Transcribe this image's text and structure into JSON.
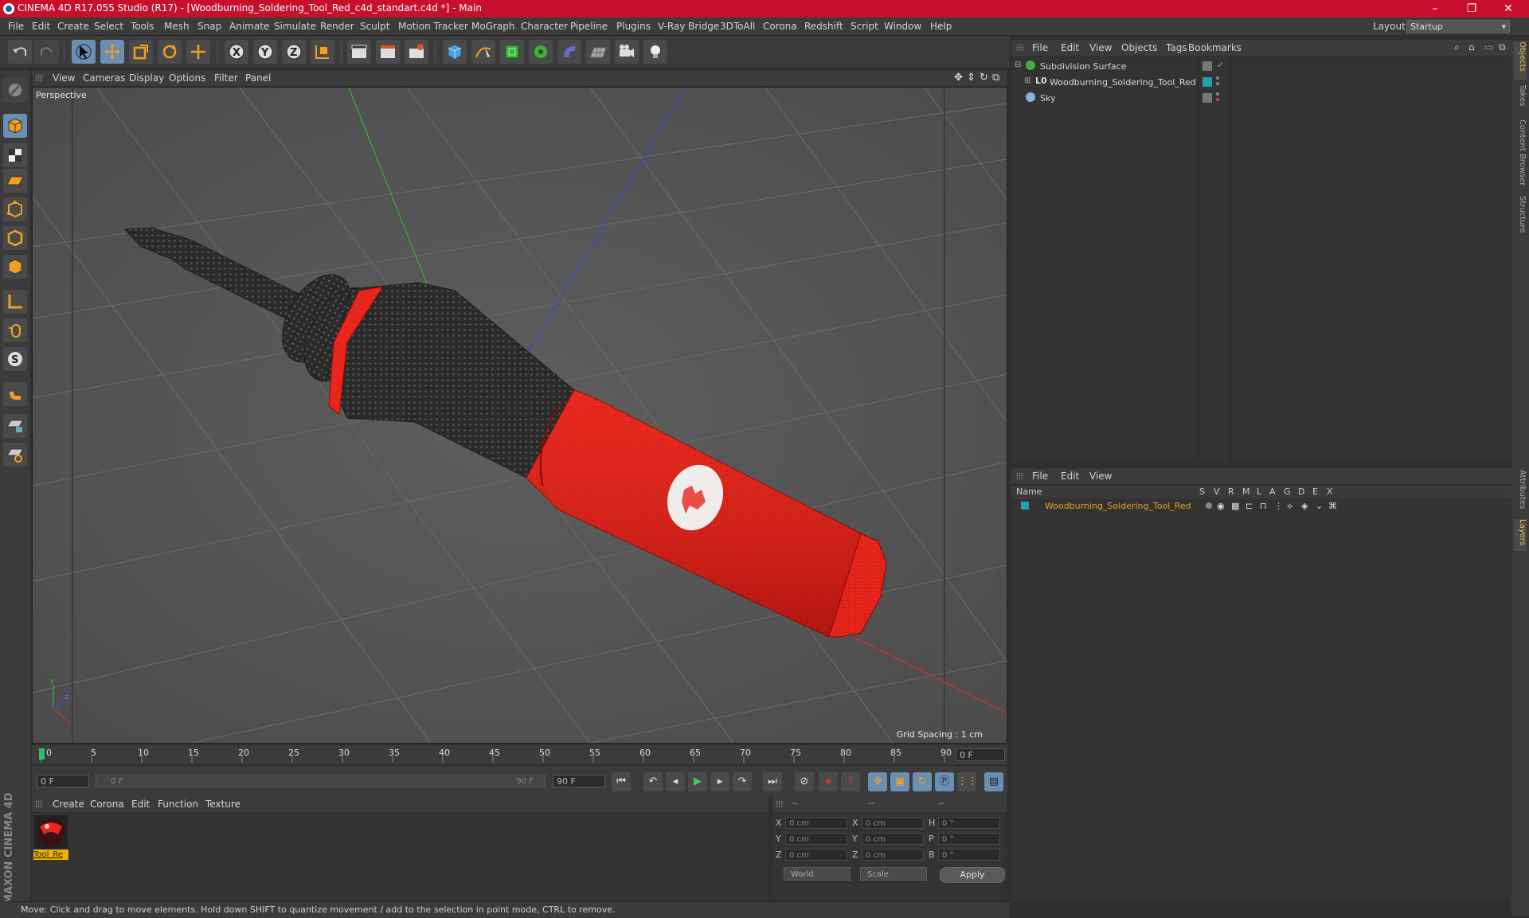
{
  "window": {
    "title": "CINEMA 4D R17.055 Studio (R17) - [Woodburning_Soldering_Tool_Red_c4d_standart.c4d *] - Main",
    "controls": [
      "–",
      "❐",
      "✕"
    ]
  },
  "menubar": {
    "items": [
      "File",
      "Edit",
      "Create",
      "Select",
      "Tools",
      "Mesh",
      "Snap",
      "Animate",
      "Simulate",
      "Render",
      "Sculpt",
      "Motion Tracker",
      "MoGraph",
      "Character",
      "Pipeline",
      "Plugins",
      "V-Ray Bridge",
      "3DToAll",
      "Corona",
      "Redshift",
      "Script",
      "Window",
      "Help"
    ],
    "layout_label": "Layout:",
    "layout_value": "Startup"
  },
  "viewport": {
    "menu": [
      "View",
      "Cameras",
      "Display",
      "Options",
      "Filter",
      "Panel"
    ],
    "label": "Perspective",
    "grid_spacing": "Grid Spacing : 1 cm"
  },
  "timeline": {
    "ticks": [
      "0",
      "5",
      "10",
      "15",
      "20",
      "25",
      "30",
      "35",
      "40",
      "45",
      "50",
      "55",
      "60",
      "65",
      "70",
      "75",
      "80",
      "85",
      "90"
    ],
    "current_frame": "0 F",
    "start_field": "0 F",
    "range_start": "0 F",
    "range_end": "90 F",
    "end_field": "90 F"
  },
  "material_manager": {
    "menu": [
      "Create",
      "Corona",
      "Edit",
      "Function",
      "Texture"
    ],
    "material_name": "Tool_Re"
  },
  "coordinates": {
    "header": [
      "--",
      "--",
      "--"
    ],
    "rows": [
      {
        "l1": "X",
        "v1": "0 cm",
        "l2": "X",
        "v2": "0 cm",
        "l3": "H",
        "v3": "0 °"
      },
      {
        "l1": "Y",
        "v1": "0 cm",
        "l2": "Y",
        "v2": "0 cm",
        "l3": "P",
        "v3": "0 °"
      },
      {
        "l1": "Z",
        "v1": "0 cm",
        "l2": "Z",
        "v2": "0 cm",
        "l3": "B",
        "v3": "0 °"
      }
    ],
    "mode_world": "World",
    "mode_scale": "Scale",
    "apply_label": "Apply"
  },
  "object_manager": {
    "menu": [
      "File",
      "Edit",
      "View",
      "Objects",
      "Tags",
      "Bookmarks"
    ],
    "objects": [
      {
        "name": "Subdivision Surface"
      },
      {
        "name": "Woodburning_Soldering_Tool_Red"
      },
      {
        "name": "Sky"
      }
    ]
  },
  "layers_manager": {
    "menu": [
      "File",
      "Edit",
      "View"
    ],
    "columns": [
      "Name",
      "S",
      "V",
      "R",
      "M",
      "L",
      "A",
      "G",
      "D",
      "E",
      "X"
    ],
    "layer_name": "Woodburning_Soldering_Tool_Red"
  },
  "right_tabs": [
    "Objects",
    "Takes",
    "Content Browser",
    "Structure",
    "Attributes",
    "Layers"
  ],
  "status": "Move: Click and drag to move elements. Hold down SHIFT to quantize movement / add to the selection in point mode, CTRL to remove.",
  "brand": "MAXON CINEMA 4D",
  "colors": {
    "title_bar": "#c8102e",
    "accent": "#6a8fb5",
    "layer_name": "#e8a020",
    "object_red": "#e8261c"
  }
}
